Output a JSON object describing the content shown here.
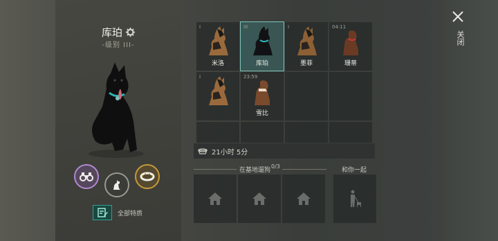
{
  "selected_dog": {
    "name": "库珀",
    "level": "-级别 III-"
  },
  "actions": {
    "traits_label": "全部特质"
  },
  "dog_grid": [
    {
      "tag": "I",
      "name": "米洛",
      "selected": false,
      "coat": "tan"
    },
    {
      "tag": "III",
      "name": "库珀",
      "selected": true,
      "coat": "black"
    },
    {
      "tag": "I",
      "name": "墨菲",
      "selected": false,
      "coat": "tan"
    },
    {
      "tag": "04:11",
      "name": "珊蒂",
      "selected": false,
      "coat": "brown"
    },
    {
      "tag": "I",
      "name": "",
      "selected": false,
      "coat": "tan"
    },
    {
      "tag": "23:59",
      "name": "雪比",
      "selected": false,
      "coat": "brown"
    }
  ],
  "timer": {
    "text": "21小时 5分"
  },
  "base_section": {
    "label": "在基地遛狗",
    "count": "0/3"
  },
  "with_you_section": {
    "label": "和你一起"
  },
  "close": {
    "label": "关闭"
  },
  "colors": {
    "accent_teal": "#7ec4bc",
    "binoculars_ring": "#b08ad0",
    "collar_ring": "#c79a3a"
  }
}
